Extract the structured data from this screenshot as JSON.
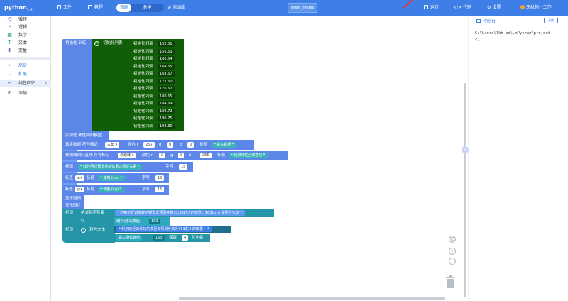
{
  "header": {
    "logo_text": "python",
    "logo_version": "3.6",
    "menu_file": "文件",
    "menu_tutorial": "教程",
    "mode_blocks": "普通",
    "mode_code": "教学",
    "menu_add_library": "添加库",
    "filename": "linear_regres",
    "run_label": "运行",
    "code_label": "代码",
    "settings_label": "设置",
    "user_label": "天机狗 · 工作"
  },
  "sidebar": {
    "categories": [
      {
        "label": "循环",
        "icon": "⟲",
        "color": "#4a6fd1"
      },
      {
        "label": "逻辑",
        "icon": "⑂",
        "color": "#4a6fd1"
      },
      {
        "label": "数学",
        "icon": "▦",
        "color": "#2aa35c"
      },
      {
        "label": "文本",
        "icon": "T",
        "color": "#2496a8"
      },
      {
        "label": "变量",
        "icon": "✤",
        "color": "#7a4fd1"
      }
    ],
    "extra": [
      {
        "label": "高级",
        "icon": "›",
        "color": "#3d7fe6"
      },
      {
        "label": "扩展",
        "icon": "⌄",
        "color": "#e0663a"
      }
    ],
    "lib": {
      "label": "线性回归",
      "icon": "⌐",
      "close": "×"
    },
    "add": {
      "label": "添加",
      "icon": "⚙"
    }
  },
  "blocks": {
    "init_training": "初始化 训练",
    "init_list": "初始化列表",
    "init_list_item": "初始化列表",
    "heights": [
      "152.51",
      "156.53",
      "160.54",
      "164.55",
      "168.57",
      "172.60",
      "176.62",
      "180.65",
      "184.69",
      "188.72",
      "190.75",
      "198.80"
    ],
    "instantiate": "实例化 线性回归模型",
    "scatter_label": "真实数据 符号标记",
    "scatter_marker": "三角",
    "color_r_label": "颜色 r",
    "scatter_r": "255",
    "g_label": "g",
    "scatter_g": "0",
    "b_label": "b",
    "scatter_b": "0",
    "title_label": "标题",
    "scatter_title": "真实数据",
    "line_label": "预测线回归直线 符号标记",
    "line_marker": "点划线",
    "line_r": "0",
    "line_g": "0",
    "line_b": "255",
    "line_title": "预测线性回归直线",
    "chart_title_label": "标题",
    "chart_title": "线性回归预测身高体重之间的关系",
    "font_size_label": "字号",
    "chart_title_size": "15",
    "xlabel_label": "标签",
    "x_axis": "x",
    "xlabel": "身高 (cm)",
    "xlabel_size": "15",
    "ylabel_label": "标签",
    "y_axis": "y",
    "ylabel": "体重 (kg)",
    "ylabel_size": "15",
    "show_legend": "显示图例",
    "show_image": "显示图片",
    "print1": "打印",
    "format_str": "格式化字符串",
    "format_template": "利用已经训练好的模型去预测身高为163的人的体重，163(cm) 体重为%.2f",
    "percent": "%",
    "predict_label": "输入测试数值",
    "predict_value": "163",
    "print2": "打印",
    "to_text": "转为文本",
    "text_prefix": "利用已经训练好的模型去预测身高为163的人的体重：",
    "predict_label2": "输入测试数值",
    "predict_value2": "163",
    "keep_label": "保留",
    "decimals": "4",
    "decimals_suffix": "位小数"
  },
  "panel": {
    "title": "控制台",
    "clear_btn": "清除",
    "console_lines": [
      "C:\\Users\\lkh-pc\\.mPython\\project",
      ">_"
    ]
  }
}
